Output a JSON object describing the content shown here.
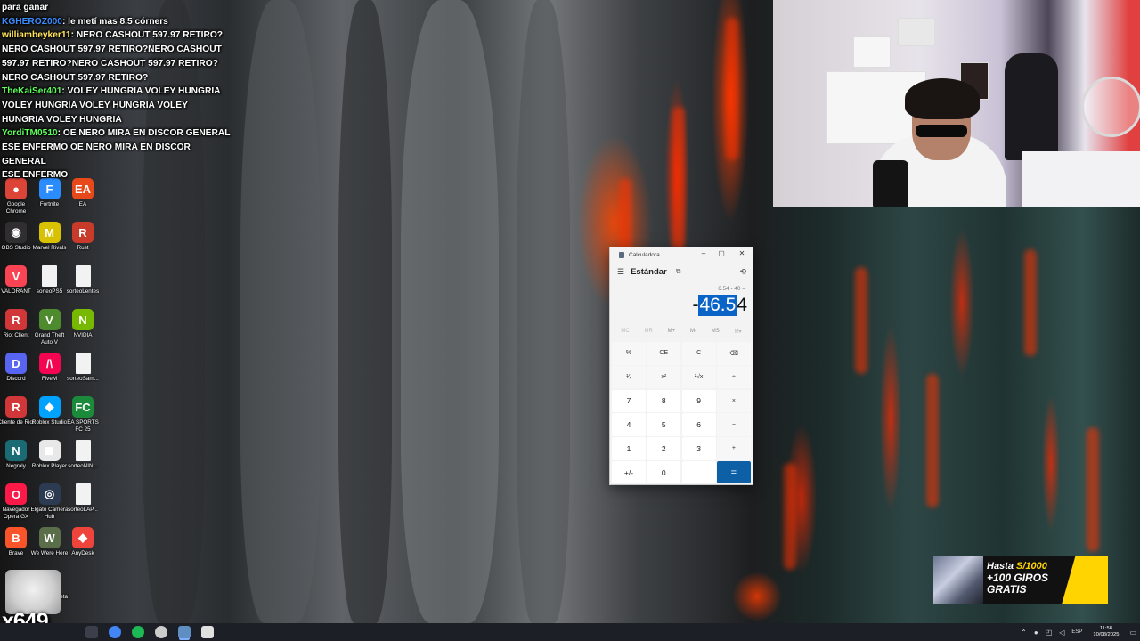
{
  "chat": [
    {
      "user": "",
      "user_color": "#ffffff",
      "message": "para ganar"
    },
    {
      "user": "KGHEROZ000",
      "user_color": "#3b8cff",
      "message": ": le metí mas 8.5 córners"
    },
    {
      "user": "williambeyker11",
      "user_color": "#ffe45c",
      "message": ": NERO CASHOUT 597.97 RETIRO?"
    },
    {
      "user": "",
      "user_color": "#ffffff",
      "message": "NERO CASHOUT 597.97 RETIRO?NERO CASHOUT"
    },
    {
      "user": "",
      "user_color": "#ffffff",
      "message": "597.97 RETIRO?NERO CASHOUT 597.97 RETIRO?"
    },
    {
      "user": "",
      "user_color": "#ffffff",
      "message": "NERO CASHOUT 597.97 RETIRO?"
    },
    {
      "user": "TheKaiSer401",
      "user_color": "#5cff5c",
      "message": ": VOLEY HUNGRIA  VOLEY HUNGRIA"
    },
    {
      "user": "",
      "user_color": "#ffffff",
      "message": " VOLEY HUNGRIA  VOLEY HUNGRIA  VOLEY"
    },
    {
      "user": "",
      "user_color": "#ffffff",
      "message": "HUNGRIA  VOLEY HUNGRIA "
    },
    {
      "user": "YordiTM0510",
      "user_color": "#5cff5c",
      "message": ": OE NERO MIRA EN DISCOR GENERAL"
    },
    {
      "user": "",
      "user_color": "#ffffff",
      "message": "ESE ENFERMO OE NERO MIRA EN DISCOR GENERAL"
    },
    {
      "user": "",
      "user_color": "#ffffff",
      "message": "ESE ENFERMO"
    }
  ],
  "desktop_icons": [
    {
      "label": "Google Chrome",
      "icon": "chrome-icon",
      "color": "#db4437",
      "glyph": "●"
    },
    {
      "label": "Fortnite",
      "icon": "fortnite-icon",
      "color": "#2a8cff",
      "glyph": "F"
    },
    {
      "label": "EA",
      "icon": "ea-icon",
      "color": "#e8491b",
      "glyph": "EA"
    },
    {
      "label": "OBS Studio",
      "icon": "obs-icon",
      "color": "#302e31",
      "glyph": "◉"
    },
    {
      "label": "Marvel Rivals",
      "icon": "marvel-rivals-icon",
      "color": "#d8c100",
      "glyph": "M"
    },
    {
      "label": "Rust",
      "icon": "rust-icon",
      "color": "#c83a2a",
      "glyph": "R"
    },
    {
      "label": "VALORANT",
      "icon": "valorant-icon",
      "color": "#fa4454",
      "glyph": "V"
    },
    {
      "label": "sorteoPS5",
      "icon": "file-icon",
      "color": "#f2f2f2",
      "glyph": ""
    },
    {
      "label": "sorteoLentes",
      "icon": "file-icon",
      "color": "#f2f2f2",
      "glyph": ""
    },
    {
      "label": "Riot Client",
      "icon": "riot-client-icon",
      "color": "#d13639",
      "glyph": "R"
    },
    {
      "label": "Grand Theft Auto V",
      "icon": "gta-icon",
      "color": "#4e8a2e",
      "glyph": "V"
    },
    {
      "label": "NVIDIA",
      "icon": "nvidia-icon",
      "color": "#76b900",
      "glyph": "N"
    },
    {
      "label": "Discord",
      "icon": "discord-icon",
      "color": "#5865f2",
      "glyph": "D"
    },
    {
      "label": "FiveM",
      "icon": "fivem-icon",
      "color": "#f40552",
      "glyph": "/\\"
    },
    {
      "label": "sorteoSam...",
      "icon": "file-icon",
      "color": "#f2f2f2",
      "glyph": ""
    },
    {
      "label": "Cliente de Riot",
      "icon": "riot-client-icon",
      "color": "#d13639",
      "glyph": "R"
    },
    {
      "label": "Roblox Studio",
      "icon": "roblox-studio-icon",
      "color": "#00a2ff",
      "glyph": "◆"
    },
    {
      "label": "EA SPORTS FC 25",
      "icon": "ea-fc-icon",
      "color": "#1b8a3a",
      "glyph": "FC"
    },
    {
      "label": "Negraly",
      "icon": "negraly-icon",
      "color": "#1a6b73",
      "glyph": "N"
    },
    {
      "label": "Roblox Player",
      "icon": "roblox-icon",
      "color": "#e8e8e8",
      "glyph": "◼"
    },
    {
      "label": "sorteoNIN...",
      "icon": "file-icon",
      "color": "#f2f2f2",
      "glyph": ""
    },
    {
      "label": "Navegador Opera GX",
      "icon": "opera-gx-icon",
      "color": "#fe1a48",
      "glyph": "O"
    },
    {
      "label": "Elgato Camera Hub",
      "icon": "elgato-icon",
      "color": "#2c3a52",
      "glyph": "◎"
    },
    {
      "label": "sorteoLAP...",
      "icon": "file-icon",
      "color": "#f2f2f2",
      "glyph": ""
    },
    {
      "label": "Brave",
      "icon": "brave-icon",
      "color": "#fb542b",
      "glyph": "B"
    },
    {
      "label": "We Were Here",
      "icon": "we-were-here-icon",
      "color": "#5a6e4a",
      "glyph": "W"
    },
    {
      "label": "AnyDesk",
      "icon": "anydesk-icon",
      "color": "#ef443b",
      "glyph": "◆"
    },
    {
      "label": "",
      "icon": "blank",
      "color": "transparent",
      "glyph": ""
    },
    {
      "label": "Nueva carpeta (2)",
      "icon": "folder-icon",
      "color": "#f0c040",
      "glyph": ""
    }
  ],
  "calculator": {
    "window_title": "Calculadora",
    "mode": "Estándar",
    "expression": "6.54 - 40 =",
    "display_prefix": "-",
    "display_selected": "46.5",
    "display_suffix": "4",
    "memory": [
      "MC",
      "MR",
      "M+",
      "M-",
      "MS",
      "M▾"
    ],
    "keys": [
      {
        "label": "%",
        "kind": "fn",
        "name": "percent-key"
      },
      {
        "label": "CE",
        "kind": "fn",
        "name": "clear-entry-key"
      },
      {
        "label": "C",
        "kind": "fn",
        "name": "clear-key"
      },
      {
        "label": "⌫",
        "kind": "fn",
        "name": "backspace-key"
      },
      {
        "label": "¹⁄ₓ",
        "kind": "fn",
        "name": "reciprocal-key"
      },
      {
        "label": "x²",
        "kind": "fn",
        "name": "square-key"
      },
      {
        "label": "²√x",
        "kind": "fn",
        "name": "sqrt-key"
      },
      {
        "label": "÷",
        "kind": "fn",
        "name": "divide-key"
      },
      {
        "label": "7",
        "kind": "num",
        "name": "digit-7-key"
      },
      {
        "label": "8",
        "kind": "num",
        "name": "digit-8-key"
      },
      {
        "label": "9",
        "kind": "num",
        "name": "digit-9-key"
      },
      {
        "label": "×",
        "kind": "fn",
        "name": "multiply-key"
      },
      {
        "label": "4",
        "kind": "num",
        "name": "digit-4-key"
      },
      {
        "label": "5",
        "kind": "num",
        "name": "digit-5-key"
      },
      {
        "label": "6",
        "kind": "num",
        "name": "digit-6-key"
      },
      {
        "label": "−",
        "kind": "fn",
        "name": "subtract-key"
      },
      {
        "label": "1",
        "kind": "num",
        "name": "digit-1-key"
      },
      {
        "label": "2",
        "kind": "num",
        "name": "digit-2-key"
      },
      {
        "label": "3",
        "kind": "num",
        "name": "digit-3-key"
      },
      {
        "label": "+",
        "kind": "fn",
        "name": "add-key"
      },
      {
        "label": "+/-",
        "kind": "num",
        "name": "negate-key"
      },
      {
        "label": "0",
        "kind": "num",
        "name": "digit-0-key"
      },
      {
        "label": ".",
        "kind": "num",
        "name": "decimal-key"
      },
      {
        "label": "=",
        "kind": "eq",
        "name": "equals-key"
      }
    ]
  },
  "promo": {
    "line1_prefix": "Hasta ",
    "line1_amount": "S/1000",
    "line2": "+100 GIROS",
    "line3": "GRATIS"
  },
  "overlay_counter": "x649",
  "taskbar": {
    "apps": [
      {
        "name": "start-button",
        "color": "#1c1f26"
      },
      {
        "name": "search-button",
        "color": "#3a3f4a"
      },
      {
        "name": "chrome-taskbar",
        "color": "#4285f4"
      },
      {
        "name": "spotify-taskbar",
        "color": "#1db954"
      },
      {
        "name": "obs-taskbar",
        "color": "#cccccc"
      },
      {
        "name": "calculator-taskbar",
        "color": "#5f8fc2"
      },
      {
        "name": "streamlabs-taskbar",
        "color": "#e0e0e0"
      }
    ],
    "language": "ESP",
    "time": "11:58",
    "date": "10/08/2025"
  },
  "colors": {
    "accent": "#0a64c8",
    "equals": "#0d5fa6"
  }
}
